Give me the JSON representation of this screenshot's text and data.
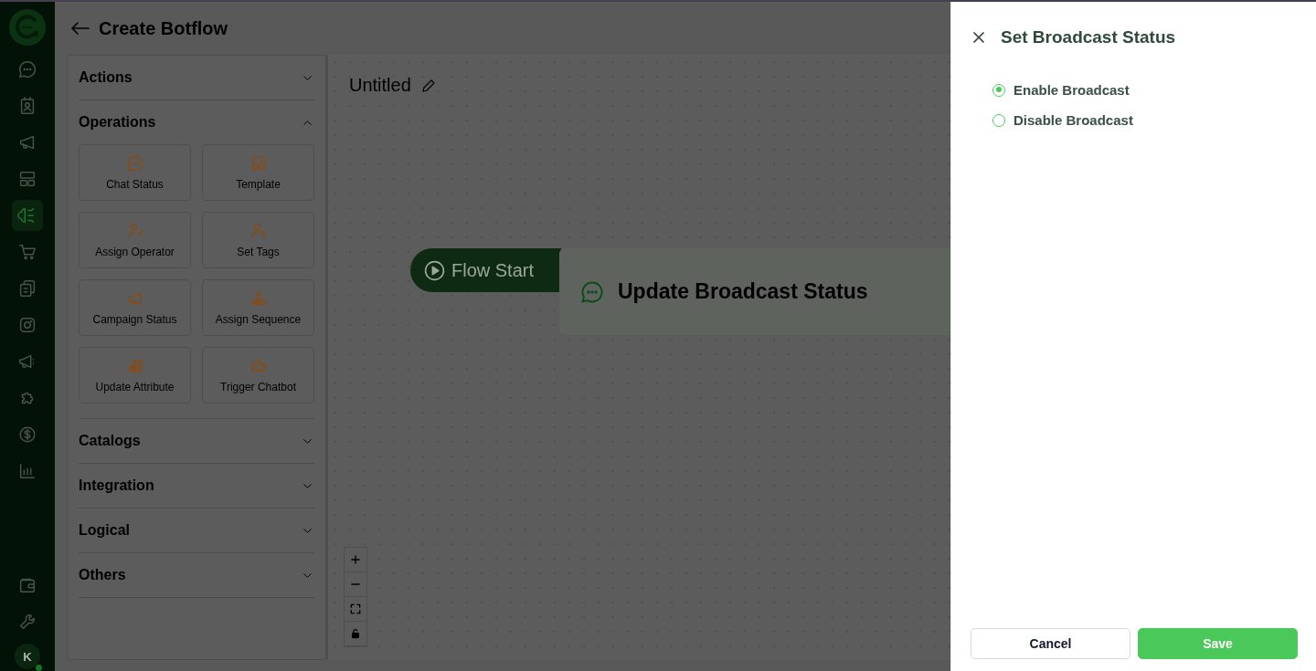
{
  "nav": {
    "items": [
      {
        "kind": "chat",
        "selected": false
      },
      {
        "kind": "contacts",
        "selected": false
      },
      {
        "kind": "megaphone",
        "selected": false
      },
      {
        "kind": "grid",
        "selected": false
      },
      {
        "kind": "bot",
        "selected": true
      },
      {
        "kind": "cart",
        "selected": false
      },
      {
        "kind": "docs",
        "selected": false
      },
      {
        "kind": "instagram",
        "selected": false
      },
      {
        "kind": "broadcast",
        "selected": false
      },
      {
        "kind": "puzzle",
        "selected": false
      },
      {
        "kind": "dollar",
        "selected": false
      },
      {
        "kind": "chart",
        "selected": false
      }
    ],
    "bottom": [
      {
        "kind": "wallet",
        "selected": false
      },
      {
        "kind": "wrench",
        "selected": false
      }
    ],
    "avatar": {
      "initial": "K",
      "online": true
    }
  },
  "header": {
    "title": "Create Botflow"
  },
  "palette": {
    "sections": [
      {
        "title": "Actions",
        "expanded": false
      },
      {
        "title": "Operations",
        "expanded": true,
        "items": [
          {
            "label": "Chat Status",
            "kind": "chat"
          },
          {
            "label": "Template",
            "kind": "grid"
          },
          {
            "label": "Assign Operator",
            "kind": "user-check"
          },
          {
            "label": "Set Tags",
            "kind": "user-tag"
          },
          {
            "label": "Campaign Status",
            "kind": "megaphone"
          },
          {
            "label": "Assign Sequence",
            "kind": "hierarchy"
          },
          {
            "label": "Update Attribute",
            "kind": "coins"
          },
          {
            "label": "Trigger Chatbot",
            "kind": "robot"
          }
        ]
      },
      {
        "title": "Catalogs",
        "expanded": false
      },
      {
        "title": "Integration",
        "expanded": false
      },
      {
        "title": "Logical",
        "expanded": false
      },
      {
        "title": "Others",
        "expanded": false
      }
    ]
  },
  "canvas": {
    "title": "Untitled",
    "start_node": {
      "label": "Flow Start"
    },
    "node": {
      "title": "Update Broadcast Status"
    },
    "controls": [
      {
        "kind": "plus"
      },
      {
        "kind": "minus"
      },
      {
        "kind": "fit"
      },
      {
        "kind": "lock"
      }
    ]
  },
  "drawer": {
    "title": "Set Broadcast Status",
    "options": [
      {
        "label": "Enable Broadcast",
        "selected": true
      },
      {
        "label": "Disable Broadcast",
        "selected": false
      }
    ],
    "buttons": [
      {
        "label": "Cancel",
        "kind": "secondary"
      },
      {
        "label": "Save",
        "kind": "primary"
      }
    ]
  }
}
